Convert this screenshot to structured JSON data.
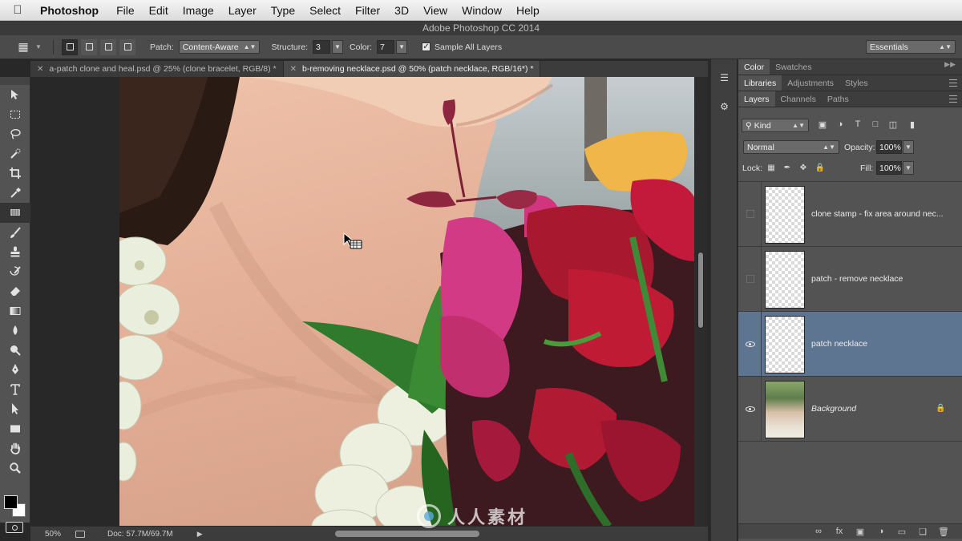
{
  "menubar": {
    "app_name": "Photoshop",
    "items": [
      "File",
      "Edit",
      "Image",
      "Layer",
      "Type",
      "Select",
      "Filter",
      "3D",
      "View",
      "Window",
      "Help"
    ]
  },
  "window_title": "Adobe Photoshop CC 2014",
  "options": {
    "patch_label": "Patch:",
    "patch_value": "Content-Aware",
    "structure_label": "Structure:",
    "structure_value": "3",
    "color_label": "Color:",
    "color_value": "7",
    "sample_all_label": "Sample All Layers",
    "sample_all_checked": true,
    "workspace": "Essentials"
  },
  "tabs": [
    {
      "label": "a-patch clone and heal.psd @ 25% (clone bracelet, RGB/8) *",
      "active": false
    },
    {
      "label": "b-removing necklace.psd @ 50% (patch necklace, RGB/16*) *",
      "active": true
    }
  ],
  "tools": [
    "move-tool",
    "marquee-tool",
    "lasso-tool",
    "quick-select-tool",
    "crop-tool",
    "eyedropper-tool",
    "patch-tool",
    "brush-tool",
    "stamp-tool",
    "history-brush-tool",
    "eraser-tool",
    "gradient-tool",
    "blur-tool",
    "dodge-tool",
    "pen-tool",
    "type-tool",
    "path-select-tool",
    "shape-tool",
    "hand-tool",
    "zoom-tool"
  ],
  "active_tool": "patch-tool",
  "status": {
    "zoom": "50%",
    "doc": "Doc: 57.7M/69.7M"
  },
  "panels": {
    "color_tabs": [
      "Color",
      "Swatches"
    ],
    "library_tabs": [
      "Libraries",
      "Adjustments",
      "Styles"
    ],
    "layer_tabs": [
      "Layers",
      "Channels",
      "Paths"
    ],
    "filter_kind": "Kind",
    "blend_mode": "Normal",
    "opacity_label": "Opacity:",
    "opacity_value": "100%",
    "lock_label": "Lock:",
    "fill_label": "Fill:",
    "fill_value": "100%"
  },
  "layers": [
    {
      "name": "clone stamp - fix area around nec...",
      "visible": false,
      "selected": false
    },
    {
      "name": "patch - remove necklace",
      "visible": false,
      "selected": false
    },
    {
      "name": "patch necklace",
      "visible": true,
      "selected": true
    },
    {
      "name": "Background",
      "visible": true,
      "selected": false,
      "locked": true
    }
  ],
  "watermark": "人人素材",
  "colors": {
    "selected_layer": "#5d7590",
    "foreground": "#000000",
    "background": "#ffffff"
  }
}
